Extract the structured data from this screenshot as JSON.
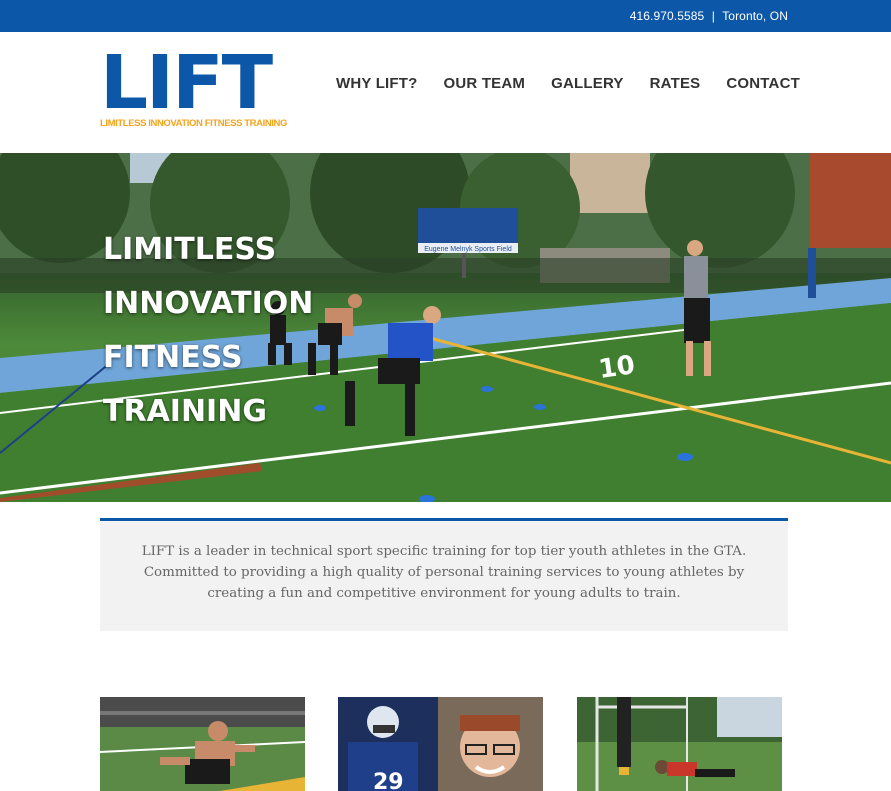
{
  "topbar": {
    "phone": "416.970.5585",
    "separator": "|",
    "location": "Toronto, ON"
  },
  "logo": {
    "word": "LIFT",
    "tagline": "LIMITLESS INNOVATION FITNESS TRAINING"
  },
  "nav": {
    "items": [
      "WHY LIFT?",
      "OUR TEAM",
      "GALLERY",
      "RATES",
      "CONTACT"
    ]
  },
  "hero": {
    "lines": [
      "LIMITLESS",
      "INNOVATION",
      "FITNESS",
      "TRAINING"
    ],
    "scoreboard_label": "Eugene Melnyk Sports Field",
    "field_number": "10"
  },
  "intro": {
    "text": "LIFT is a leader in technical sport specific training for top tier youth athletes in the GTA. Committed to providing a high quality of personal training services to young athletes by creating a fun and competitive environment for young adults to train."
  },
  "thumbnails": {
    "jersey_number": "29"
  },
  "colors": {
    "brand_blue": "#0d57a8",
    "accent_orange": "#f2a51e",
    "nav_text": "#333333"
  }
}
